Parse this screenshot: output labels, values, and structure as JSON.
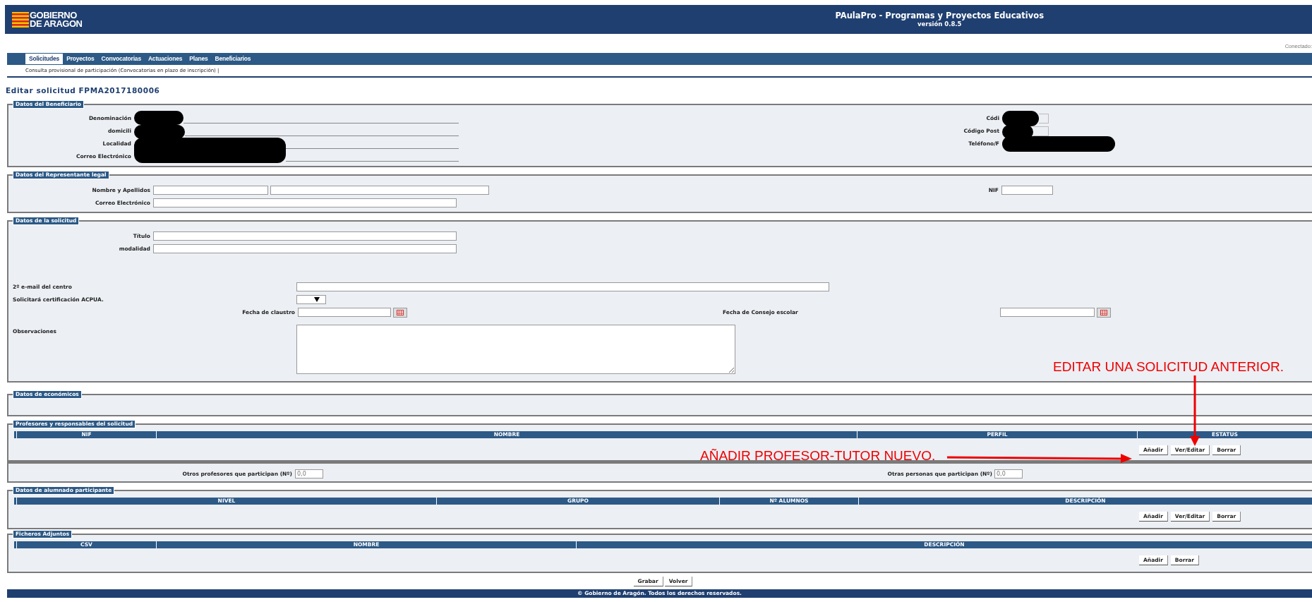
{
  "header": {
    "logo_lines": [
      "GOBIERNO",
      "DE ARAGON"
    ],
    "title": "PAulaPro - Programas y Proyectos Educativos",
    "version": "versión 0.8.5"
  },
  "connected": "Conectado:",
  "tabs": [
    {
      "label": "Solicitudes",
      "selected": true
    },
    {
      "label": "Proyectos",
      "selected": false
    },
    {
      "label": "Convocatorias",
      "selected": false
    },
    {
      "label": "Actuaciones",
      "selected": false
    },
    {
      "label": "Planes",
      "selected": false
    },
    {
      "label": "Beneficiarios",
      "selected": false
    }
  ],
  "subnav": "Consulta provisional de participación (Convocatorias en plazo de inscripción) |",
  "page_title": "Editar solicitud FPMA2017180006",
  "beneficiario": {
    "legend": "Datos del Beneficiario",
    "left_labels": [
      "Denominación",
      "domicili",
      "Localidad",
      "Correo Electrónico"
    ],
    "right_labels": [
      "Códi",
      "Código Post",
      "Teléfono/F"
    ]
  },
  "representante": {
    "legend": "Datos del Representante legal",
    "name_label": "Nombre y Apellidos",
    "email_label": "Correo Electrónico",
    "nif_label": "NIF"
  },
  "solicitud": {
    "legend": "Datos de la solicitud",
    "titulo_label": "Título",
    "modalidad_label": "modalidad",
    "email2_label": "2º e-mail del centro",
    "acpua_label": "Solicitará certificación ACPUA.",
    "claustro_label": "Fecha de claustro",
    "consejo_label": "Fecha de Consejo escolar",
    "observaciones_label": "Observaciones"
  },
  "economicos": {
    "legend": "Datos de económicos"
  },
  "profesores": {
    "legend": "Profesores y responsables del solicitud",
    "columns": [
      "NIF",
      "NOMBRE",
      "PERFIL",
      "ESTATUS"
    ],
    "buttons": [
      "Añadir",
      "Ver/Editar",
      "Borrar"
    ]
  },
  "otros": {
    "profesores_label": "Otros profesores que participan (Nº)",
    "profesores_value": "0,0",
    "personas_label": "Otras personas que participan (Nº)",
    "personas_value": "0,0"
  },
  "alumnado": {
    "legend": "Datos de alumnado participante",
    "columns": [
      "NIVEL",
      "GRUPO",
      "Nº ALUMNOS",
      "DESCRIPCIÓN"
    ],
    "buttons": [
      "Añadir",
      "Ver/Editar",
      "Borrar"
    ]
  },
  "ficheros": {
    "legend": "Ficheros Adjuntos",
    "columns": [
      "CSV",
      "NOMBRE",
      "DESCRIPCIÓN"
    ],
    "buttons": [
      "Añadir",
      "Borrar"
    ]
  },
  "actions": [
    "Grabar",
    "Volver"
  ],
  "annotations": [
    {
      "text": "EDITAR UNA SOLICITUD ANTERIOR."
    },
    {
      "text": "AÑADIR PROFESOR-TUTOR NUEVO."
    }
  ],
  "footer": "© Gobierno de Aragón. Todos los derechos reservados."
}
